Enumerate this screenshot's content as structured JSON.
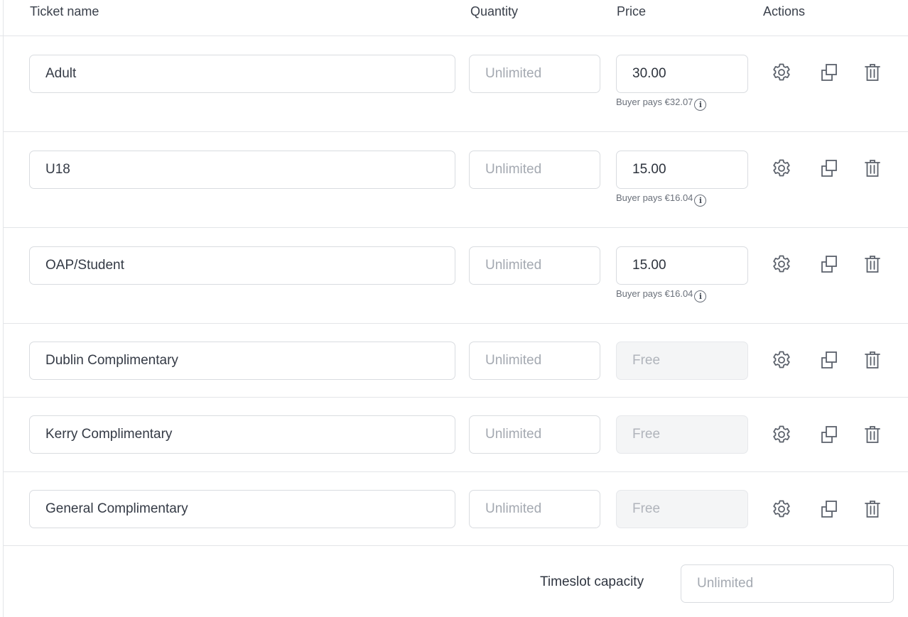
{
  "header": {
    "ticket_name": "Ticket name",
    "quantity": "Quantity",
    "price": "Price",
    "actions": "Actions"
  },
  "icons": {
    "settings": "gear-icon",
    "duplicate": "duplicate-icon",
    "delete": "trash-icon"
  },
  "tickets": [
    {
      "name": "Adult",
      "quantity_placeholder": "Unlimited",
      "price": "30.00",
      "buyer_pays": "Buyer pays €32.07"
    },
    {
      "name": "U18",
      "quantity_placeholder": "Unlimited",
      "price": "15.00",
      "buyer_pays": "Buyer pays €16.04"
    },
    {
      "name": "OAP/Student",
      "quantity_placeholder": "Unlimited",
      "price": "15.00",
      "buyer_pays": "Buyer pays €16.04"
    },
    {
      "name": "Dublin Complimentary",
      "quantity_placeholder": "Unlimited",
      "price": "Free"
    },
    {
      "name": "Kerry Complimentary",
      "quantity_placeholder": "Unlimited",
      "price": "Free"
    },
    {
      "name": "General Complimentary",
      "quantity_placeholder": "Unlimited",
      "price": "Free"
    }
  ],
  "footer": {
    "timeslot_capacity_label": "Timeslot capacity",
    "timeslot_capacity_placeholder": "Unlimited"
  }
}
